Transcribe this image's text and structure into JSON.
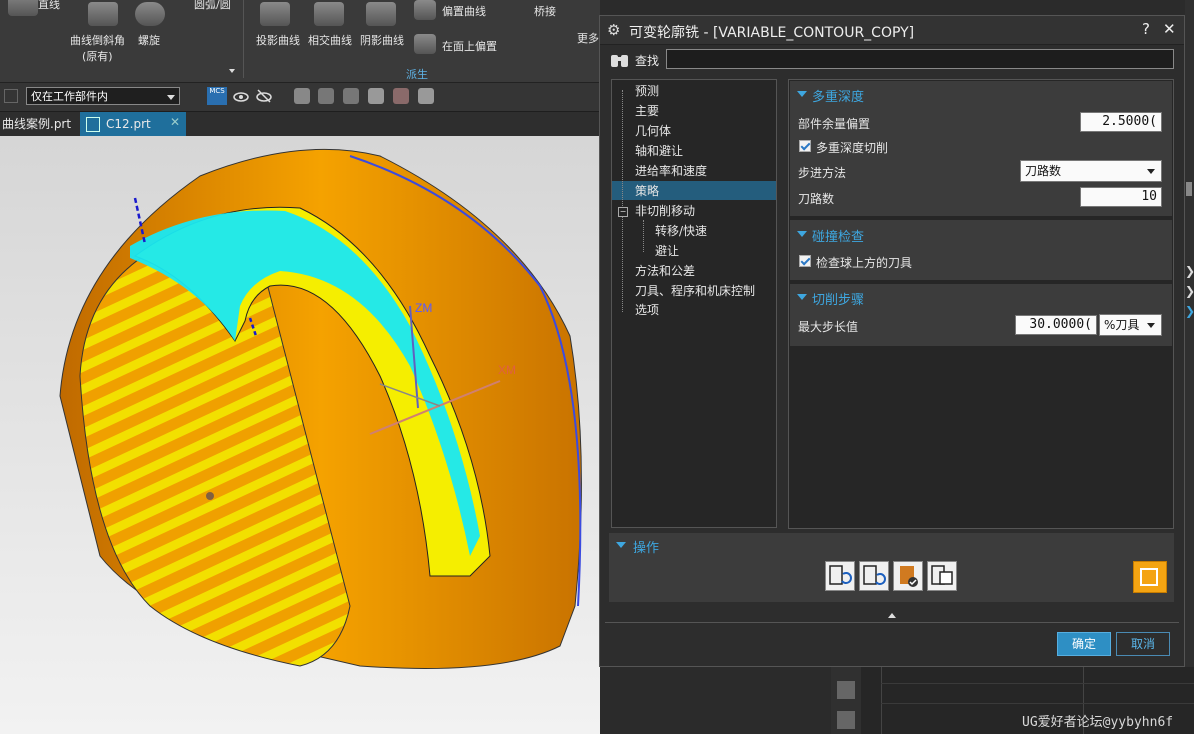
{
  "ribbon": {
    "items": [
      {
        "label": "直线"
      },
      {
        "label": "圆弧/圆"
      },
      {
        "label": "曲线倒斜角"
      },
      {
        "label": "(原有)"
      },
      {
        "label": "螺旋"
      },
      {
        "label": "投影曲线"
      },
      {
        "label": "相交曲线"
      },
      {
        "label": "阴影曲线"
      },
      {
        "label": "偏置曲线"
      },
      {
        "label": "在面上偏置"
      },
      {
        "label": "桥接"
      },
      {
        "label": "更多"
      }
    ],
    "group_label": "派生"
  },
  "toolbar": {
    "filter_value": "仅在工作部件内",
    "mcs_label": "MCS"
  },
  "tabs": [
    {
      "label": "曲线案例.prt"
    },
    {
      "label": "C12.prt"
    }
  ],
  "viewport": {
    "axis_zm": "ZM",
    "axis_xm": "XM"
  },
  "dialog": {
    "title": "可变轮廓铣 - [VARIABLE_CONTOUR_COPY]",
    "help": "?",
    "close": "✕",
    "find_label": "查找",
    "find_value": "",
    "tree": [
      {
        "label": "预测"
      },
      {
        "label": "主要"
      },
      {
        "label": "几何体"
      },
      {
        "label": "轴和避让"
      },
      {
        "label": "进给率和速度"
      },
      {
        "label": "策略"
      },
      {
        "label": "非切削移动"
      },
      {
        "label": "转移/快速"
      },
      {
        "label": "避让"
      },
      {
        "label": "方法和公差"
      },
      {
        "label": "刀具、程序和机床控制"
      },
      {
        "label": "选项"
      }
    ],
    "selected_tree_item": "策略",
    "sections": {
      "multi_depth": {
        "title": "多重深度",
        "part_stock_offset_label": "部件余量偏置",
        "part_stock_offset_value": "2.5000(",
        "multi_depth_cut_label": "多重深度切削",
        "multi_depth_cut_checked": true,
        "step_method_label": "步进方法",
        "step_method_value": "刀路数",
        "passes_label": "刀路数",
        "passes_value": "10"
      },
      "collision": {
        "title": "碰撞检查",
        "check_label": "检查球上方的刀具",
        "check_checked": true
      },
      "cut_step": {
        "title": "切削步骤",
        "max_step_label": "最大步长值",
        "max_step_value": "30.0000(",
        "max_step_unit": "%刀具"
      }
    },
    "operations": {
      "title": "操作",
      "buttons": [
        {
          "icon": "generate-icon"
        },
        {
          "icon": "replay-icon"
        },
        {
          "icon": "verify-icon"
        },
        {
          "icon": "list-icon"
        }
      ]
    },
    "ok": "确定",
    "cancel": "取消"
  },
  "watermark": "UG爱好者论坛@yybyhn6f"
}
